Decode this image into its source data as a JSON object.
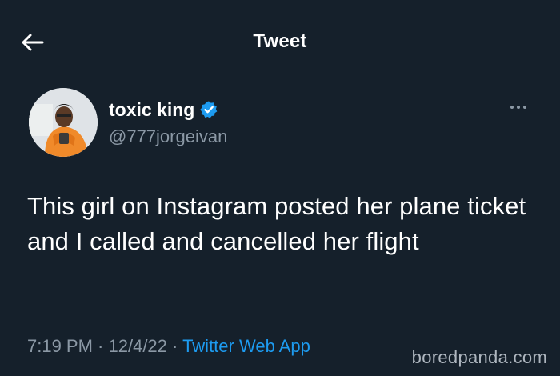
{
  "header": {
    "title": "Tweet",
    "back_icon": "arrow-left-icon"
  },
  "author": {
    "display_name": "toxic king",
    "handle": "@777jorgeivan",
    "verified": true,
    "verified_color": "#1d9bf0"
  },
  "tweet": {
    "text": "This girl on Instagram posted her plane ticket and I called and cancelled her flight",
    "time": "7:19 PM",
    "separator1": " · ",
    "date": "12/4/22",
    "separator2": " · ",
    "source": "Twitter Web App"
  },
  "watermark": "boredpanda.com",
  "colors": {
    "background": "#15202b",
    "text": "#ffffff",
    "muted": "#8b98a5",
    "accent": "#1d9bf0"
  }
}
